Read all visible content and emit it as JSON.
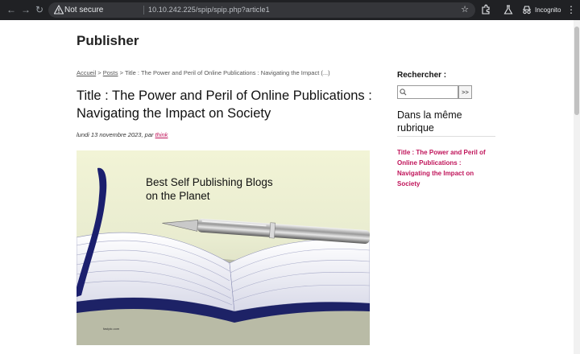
{
  "browser": {
    "security_label": "Not secure",
    "url": "10.10.242.225/spip/spip.php?article1",
    "profile_label": "Incognito"
  },
  "site": {
    "title": "Publisher"
  },
  "breadcrumb": {
    "home": "Accueil",
    "sep1": " > ",
    "section": "Posts",
    "sep2": " > ",
    "current": "Title : The Power and Peril of Online Publications : Navigating the Impact (...)"
  },
  "article": {
    "title": "Title : The Power and Peril of Online Publications : Navigating the Impact on Society",
    "date_prefix": "lundi 13 novembre 2023, par ",
    "author": "think",
    "image": {
      "caption_line1": "Best Self Publishing Blogs",
      "caption_line2": "on the Planet",
      "credit": "fastpic.com"
    }
  },
  "sidebar": {
    "search_label": "Rechercher :",
    "search_value": "",
    "search_button": ">>",
    "rubrique_title": "Dans la même rubrique",
    "rubrique_link": "Title : The Power and Peril of Online Publications : Navigating the Impact on Society"
  },
  "colors": {
    "link_accent": "#c0145a",
    "chrome_bg": "#202124"
  }
}
